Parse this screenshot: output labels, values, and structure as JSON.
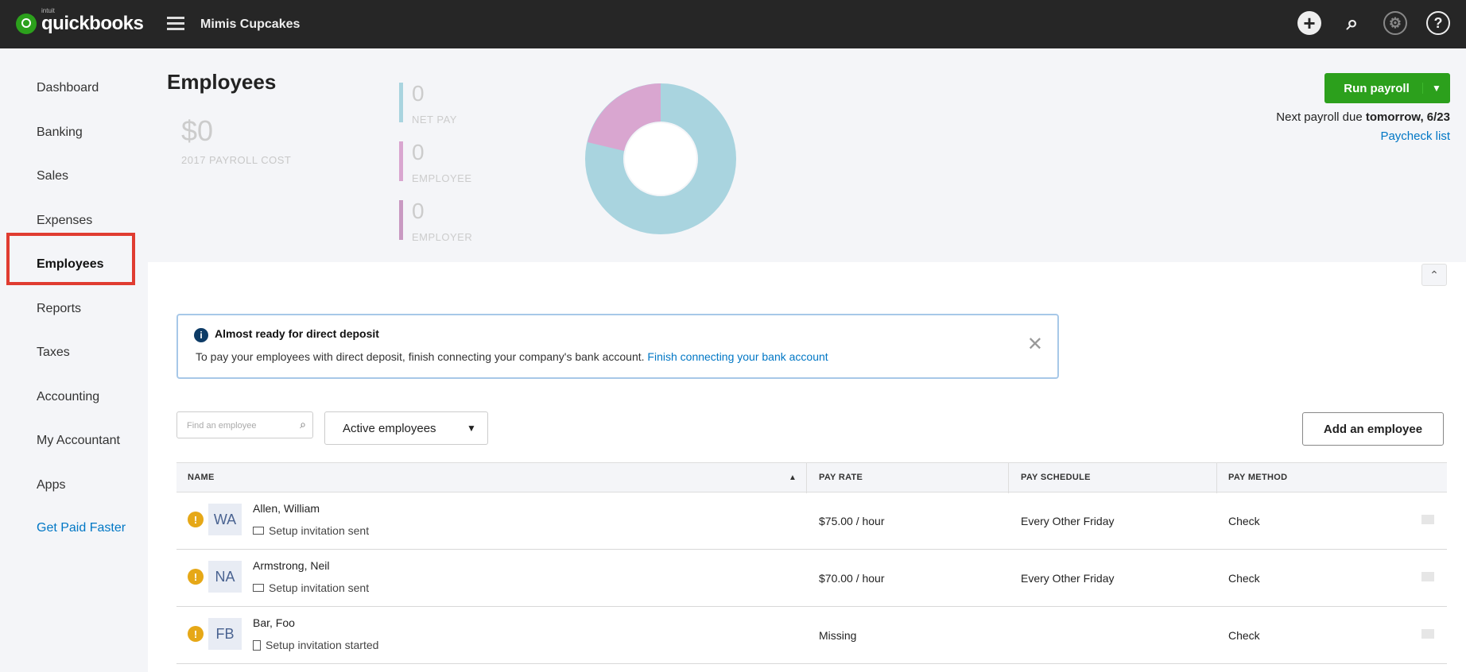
{
  "topbar": {
    "logo_text": "quickbooks",
    "logo_intuit": "intuit",
    "company": "Mimis Cupcakes",
    "icons": [
      "plus-icon",
      "search-icon",
      "gear-icon",
      "help-icon"
    ]
  },
  "sidebar": {
    "items": [
      "Dashboard",
      "Banking",
      "Sales",
      "Expenses",
      "Employees",
      "Reports",
      "Taxes",
      "Accounting",
      "My Accountant",
      "Apps"
    ],
    "active": "Employees",
    "link": "Get Paid Faster"
  },
  "summary": {
    "title": "Employees",
    "cost_value": "$0",
    "cost_label": "2017 PAYROLL COST",
    "stats": [
      {
        "value": "0",
        "label": "NET PAY",
        "color": "#a9d4df"
      },
      {
        "value": "0",
        "label": "EMPLOYEE",
        "color": "#d9a6d0"
      },
      {
        "value": "0",
        "label": "EMPLOYER",
        "color": "#c999c2"
      }
    ],
    "run_payroll": "Run payroll",
    "next_payroll_prefix": "Next payroll due ",
    "next_payroll_when": "tomorrow, 6/23",
    "paycheck_list": "Paycheck list"
  },
  "alert": {
    "title": "Almost ready for direct deposit",
    "body": "To pay your employees with direct deposit, finish connecting your company's bank account. ",
    "link": "Finish connecting your bank account"
  },
  "filters": {
    "search_placeholder": "Find an employee",
    "status_value": "Active employees",
    "add_button": "Add an employee"
  },
  "table": {
    "headers": [
      "NAME",
      "PAY RATE",
      "PAY SCHEDULE",
      "PAY METHOD"
    ],
    "rows": [
      {
        "initials": "WA",
        "name": "Allen, William",
        "status": "Setup invitation sent",
        "pay_rate": "$75.00 / hour",
        "schedule": "Every Other Friday",
        "method": "Check"
      },
      {
        "initials": "NA",
        "name": "Armstrong, Neil",
        "status": "Setup invitation sent",
        "pay_rate": "$70.00 / hour",
        "schedule": "Every Other Friday",
        "method": "Check"
      },
      {
        "initials": "FB",
        "name": "Bar, Foo",
        "status": "Setup invitation started",
        "pay_rate": "Missing",
        "schedule": "",
        "method": "Check"
      }
    ]
  },
  "colors": {
    "brand_green": "#2ca01c",
    "active_highlight": "#e03c31",
    "link_blue": "#0077c5",
    "donut_main": "#a9d4df",
    "donut_slice": "#d9a6d0"
  }
}
